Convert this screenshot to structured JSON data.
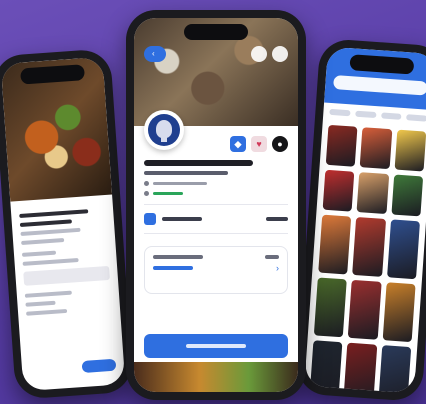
{
  "background": {
    "color_top": "#6b4fb8",
    "color_bottom": "#4a3296"
  },
  "accent_color": "#2f6fe0",
  "left_phone": {
    "photo_icon": "food-photo",
    "section_labels": [
      "",
      ""
    ]
  },
  "center_phone": {
    "back_label": "",
    "logo_icon": "shield-logo-icon",
    "badges": [
      {
        "icon": "shield-badge-icon",
        "glyph": "◆"
      },
      {
        "icon": "heart-badge-icon",
        "glyph": "♥"
      },
      {
        "icon": "dark-circle-icon",
        "glyph": "●"
      }
    ],
    "section_title": "",
    "cta_label": ""
  },
  "right_phone": {
    "tabs": 4,
    "tile_colors": [
      "#8b2a22",
      "#d95f3a",
      "#f2c94c",
      "#c22f2f",
      "#d9a16a",
      "#3f7a3a",
      "#e07b3a",
      "#b23b2e",
      "#2f4f8f",
      "#4a6a2a",
      "#9a2f2f",
      "#c9802a",
      "#1f2630",
      "#7a1f1f",
      "#2a3a5a"
    ]
  }
}
